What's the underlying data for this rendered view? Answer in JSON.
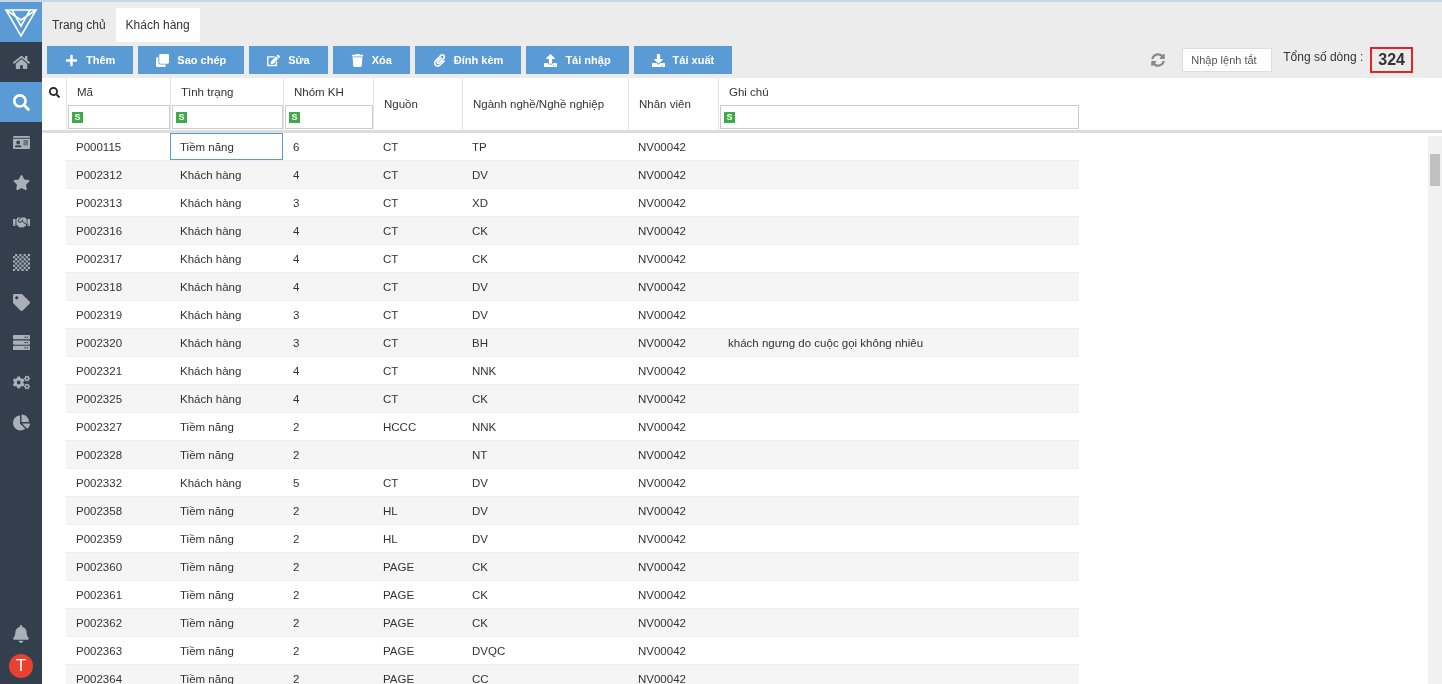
{
  "sidebar": {
    "items": [
      {
        "selected": false
      },
      {
        "selected": true
      },
      {
        "selected": false
      },
      {
        "selected": false
      },
      {
        "selected": false
      },
      {
        "selected": false
      },
      {
        "selected": false
      },
      {
        "selected": false
      },
      {
        "selected": false
      },
      {
        "selected": false
      }
    ],
    "avatar": "T"
  },
  "tabs": [
    {
      "label": "Trang chủ",
      "selected": false
    },
    {
      "label": "Khách hàng",
      "selected": true
    }
  ],
  "toolbar": {
    "buttons": [
      "Thêm",
      "Sao chép",
      "Sửa",
      "Xóa",
      "Đính kèm",
      "Tải nhập",
      "Tải xuất"
    ],
    "command": {
      "placeholder": "Nhập lệnh tắt"
    },
    "total_label": "Tổng số dòng :",
    "total": "324"
  },
  "table": {
    "columns": [
      {
        "label": "Mã",
        "filter": "S"
      },
      {
        "label": "Tình trạng",
        "filter": "S"
      },
      {
        "label": "Nhóm KH",
        "filter": "S"
      },
      {
        "label": "Nguồn"
      },
      {
        "label": "Ngành nghề/Nghề nghiệp"
      },
      {
        "label": "Nhân viên"
      },
      {
        "label": "Ghi chú",
        "filter": "S"
      }
    ],
    "rows": [
      {
        "cells": [
          "P000115",
          "Tiềm năng",
          "6",
          "CT",
          "TP",
          "NV00042",
          ""
        ],
        "focused": true
      },
      {
        "cells": [
          "P002312",
          "Khách hàng",
          "4",
          "CT",
          "DV",
          "NV00042",
          ""
        ],
        "focused": false
      },
      {
        "cells": [
          "P002313",
          "Khách hàng",
          "3",
          "CT",
          "XD",
          "NV00042",
          ""
        ],
        "focused": false
      },
      {
        "cells": [
          "P002316",
          "Khách hàng",
          "4",
          "CT",
          "CK",
          "NV00042",
          ""
        ],
        "focused": false
      },
      {
        "cells": [
          "P002317",
          "Khách hàng",
          "4",
          "CT",
          "CK",
          "NV00042",
          ""
        ],
        "focused": false
      },
      {
        "cells": [
          "P002318",
          "Khách hàng",
          "4",
          "CT",
          "DV",
          "NV00042",
          ""
        ],
        "focused": false
      },
      {
        "cells": [
          "P002319",
          "Khách hàng",
          "3",
          "CT",
          "DV",
          "NV00042",
          ""
        ],
        "focused": false
      },
      {
        "cells": [
          "P002320",
          "Khách hàng",
          "3",
          "CT",
          "BH",
          "NV00042",
          "khách ngưng do cuộc gọi không nhiêu"
        ],
        "focused": false
      },
      {
        "cells": [
          "P002321",
          "Khách hàng",
          "4",
          "CT",
          "NNK",
          "NV00042",
          ""
        ],
        "focused": false
      },
      {
        "cells": [
          "P002325",
          "Khách hàng",
          "4",
          "CT",
          "CK",
          "NV00042",
          ""
        ],
        "focused": false
      },
      {
        "cells": [
          "P002327",
          "Tiềm năng",
          "2",
          "HCCC",
          "NNK",
          "NV00042",
          ""
        ],
        "focused": false
      },
      {
        "cells": [
          "P002328",
          "Tiềm năng",
          "2",
          "",
          "NT",
          "NV00042",
          ""
        ],
        "focused": false
      },
      {
        "cells": [
          "P002332",
          "Khách hàng",
          "5",
          "CT",
          "DV",
          "NV00042",
          ""
        ],
        "focused": false
      },
      {
        "cells": [
          "P002358",
          "Tiềm năng",
          "2",
          "HL",
          "DV",
          "NV00042",
          ""
        ],
        "focused": false
      },
      {
        "cells": [
          "P002359",
          "Tiềm năng",
          "2",
          "HL",
          "DV",
          "NV00042",
          ""
        ],
        "focused": false
      },
      {
        "cells": [
          "P002360",
          "Tiềm năng",
          "2",
          "PAGE",
          "CK",
          "NV00042",
          ""
        ],
        "focused": false
      },
      {
        "cells": [
          "P002361",
          "Tiềm năng",
          "2",
          "PAGE",
          "CK",
          "NV00042",
          ""
        ],
        "focused": false
      },
      {
        "cells": [
          "P002362",
          "Tiềm năng",
          "2",
          "PAGE",
          "CK",
          "NV00042",
          ""
        ],
        "focused": false
      },
      {
        "cells": [
          "P002363",
          "Tiềm năng",
          "2",
          "PAGE",
          "DVQC",
          "NV00042",
          ""
        ],
        "focused": false
      },
      {
        "cells": [
          "P002364",
          "Tiềm năng",
          "2",
          "PAGE",
          "CC",
          "NV00042",
          ""
        ],
        "focused": false
      }
    ]
  }
}
